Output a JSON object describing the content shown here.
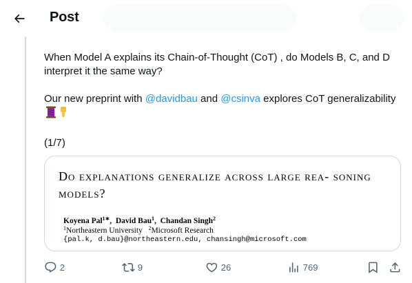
{
  "header": {
    "title": "Post"
  },
  "tweet": {
    "line1": "When Model A explains its Chain-of-Thought (CoT) , do Models B, C, and D interpret it the same way?",
    "line2_prefix": "Our new preprint with ",
    "mention1": "@davidbau",
    "line2_and": " and ",
    "mention2": "@csinva",
    "line2_suffix": " explores CoT generalizability",
    "emojis": [
      "thread-icon",
      "pointing-down-icon"
    ],
    "thread_count": "(1/7)"
  },
  "media": {
    "title": "Do explanations generalize across large rea- soning models?",
    "author1": "Koyena Pal",
    "author1_sup": "1∗",
    "author2": "David Bau",
    "author2_sup": "1",
    "author3": "Chandan Singh",
    "author3_sup": "2",
    "affil1_sup": "1",
    "affil1": "Northeastern University",
    "affil2_sup": "2",
    "affil2": "Microsoft Research",
    "emails": "{pal.k, d.bau}@northeastern.edu, chansingh@microsoft.com"
  },
  "actions": {
    "replies": "2",
    "reposts": "9",
    "likes": "26",
    "views": "769"
  },
  "colors": {
    "accent": "#1d9bf0",
    "muted": "#536471",
    "border": "#cfd9de"
  }
}
